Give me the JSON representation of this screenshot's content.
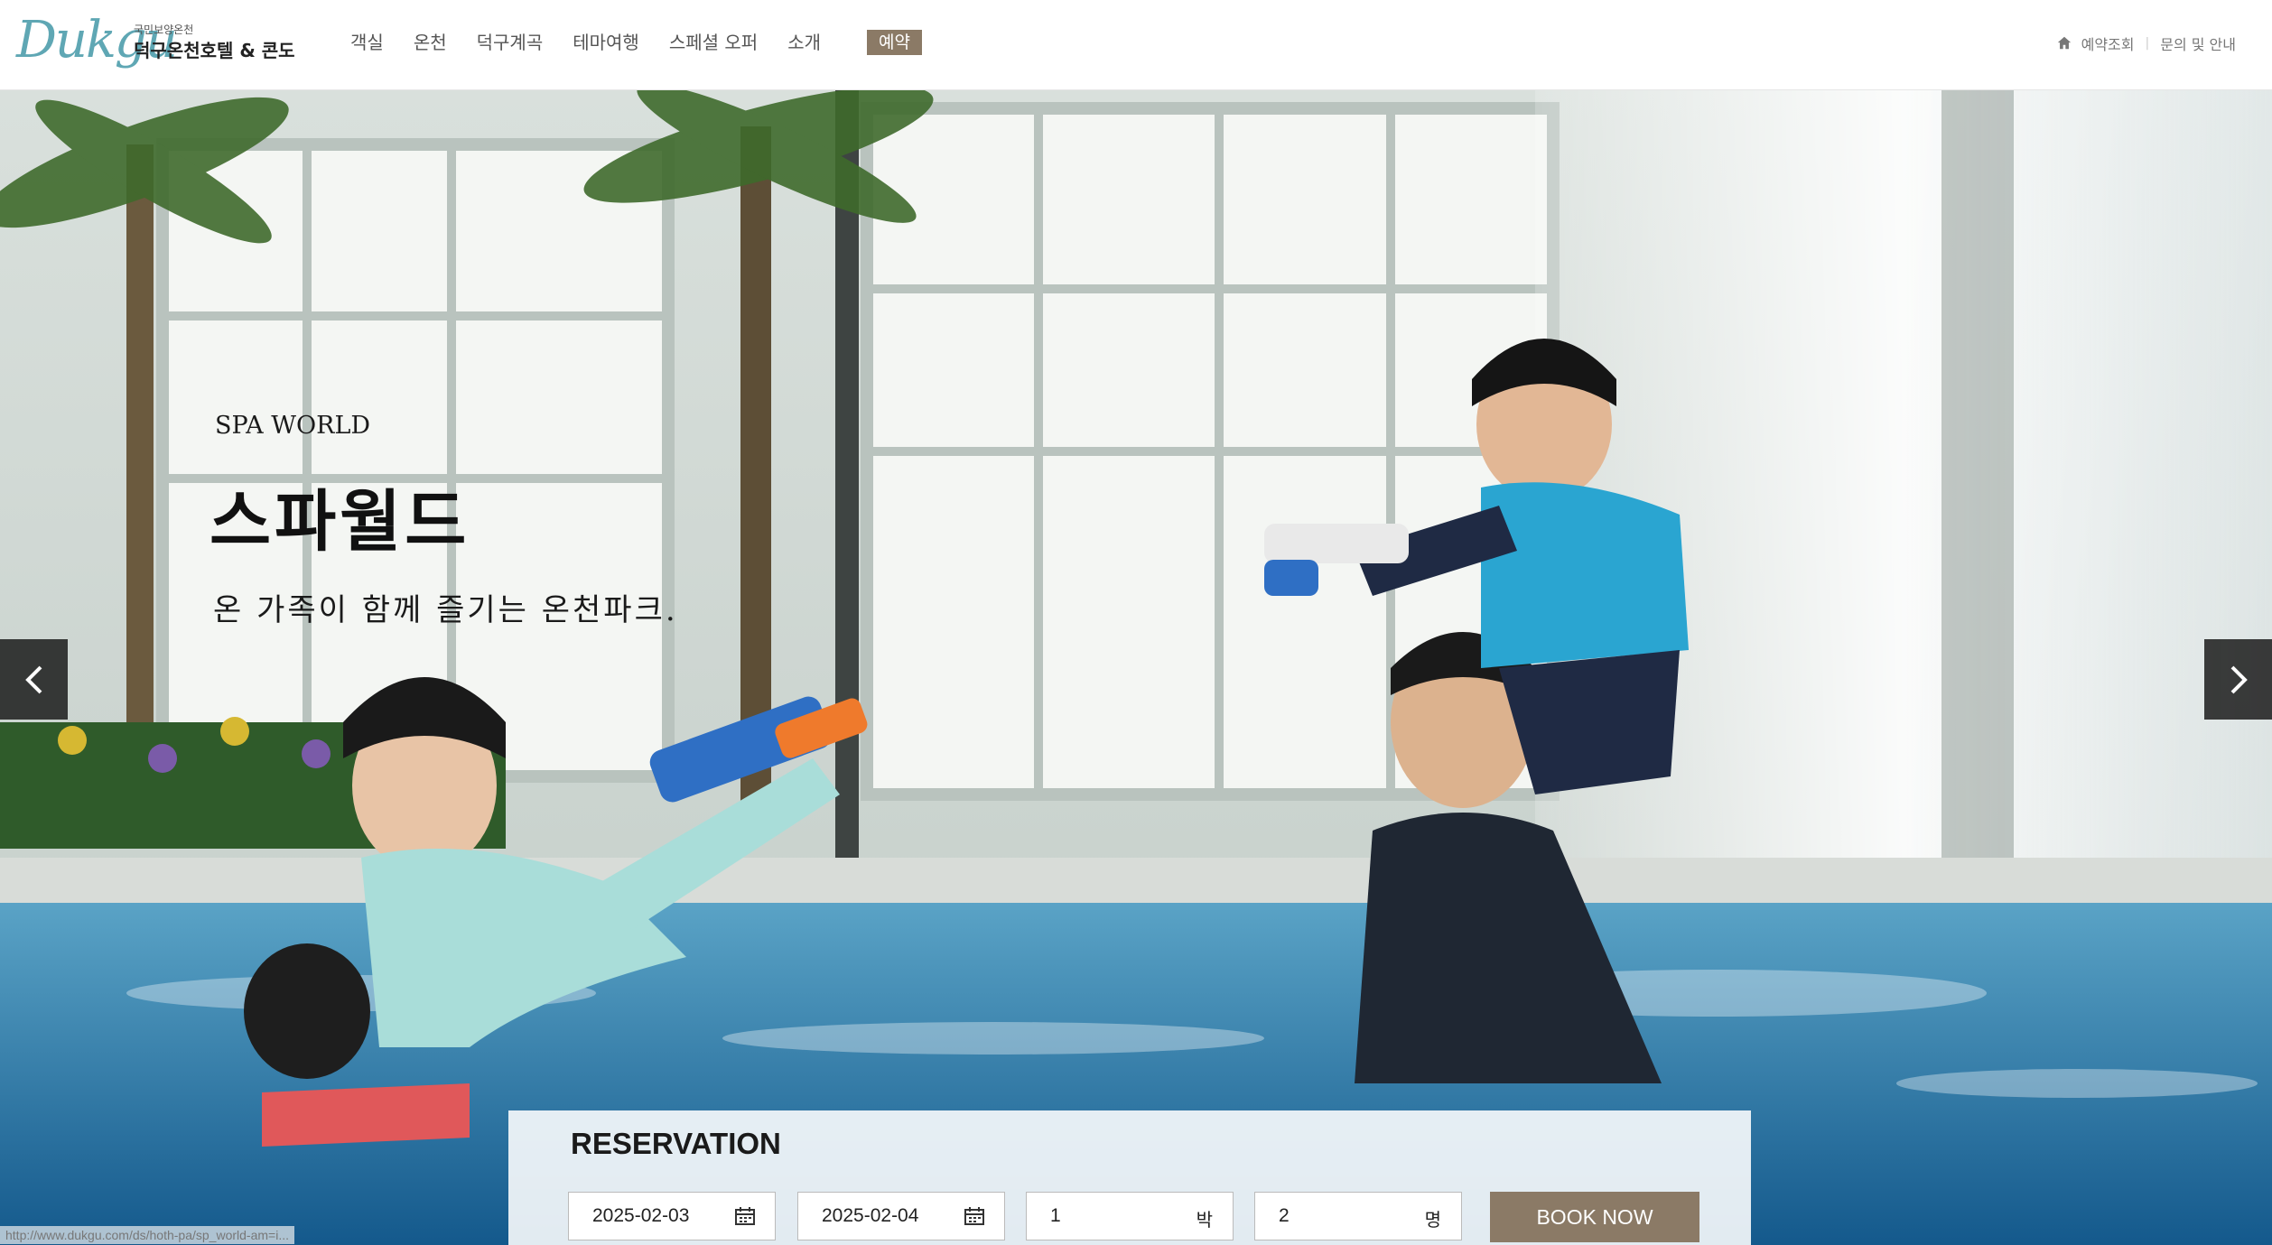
{
  "header": {
    "logo": {
      "script_text": "Dukgu",
      "small_text": "국민보양온천",
      "main_text": "덕구온천호텔 & 콘도"
    },
    "nav": [
      {
        "label": "객실"
      },
      {
        "label": "온천"
      },
      {
        "label": "덕구계곡"
      },
      {
        "label": "테마여행"
      },
      {
        "label": "스페셜 오퍼"
      },
      {
        "label": "소개"
      }
    ],
    "reserve_label": "예약",
    "util": {
      "check_label": "예약조회",
      "inquiry_label": "문의 및 안내",
      "home_icon": "home-icon"
    }
  },
  "hero": {
    "subtitle": "SPA WORLD",
    "title": "스파월드",
    "description": "온 가족이 함께 즐기는 온천파크.",
    "prev_icon": "chevron-left-icon",
    "next_icon": "chevron-right-icon"
  },
  "reservation": {
    "title": "RESERVATION",
    "checkin": "2025-02-03",
    "checkout": "2025-02-04",
    "nights": "1",
    "nights_unit": "박",
    "guests": "2",
    "guests_unit": "명",
    "book_label": "BOOK NOW",
    "calendar_icon": "calendar-icon"
  },
  "status_url": "http://www.dukgu.com/ds/hoth-pa/sp_world-am=i...",
  "colors": {
    "accent": "#8b7a66",
    "logo": "#5fa7b4",
    "arrow_bg": "#141414"
  }
}
